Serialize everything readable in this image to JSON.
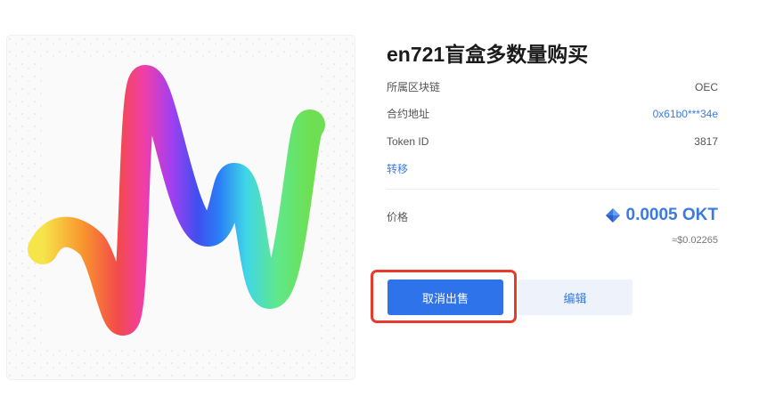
{
  "nft": {
    "title": "en721盲盒多数量购买",
    "details": [
      {
        "label": "所属区块链",
        "value": "OEC",
        "link": false
      },
      {
        "label": "合约地址",
        "value": "0x61b0***34e",
        "link": true
      },
      {
        "label": "Token ID",
        "value": "3817",
        "link": false
      }
    ],
    "transfer_label": "转移",
    "price_label": "价格",
    "price_value": "0.0005 OKT",
    "price_usd": "≈$0.02265",
    "currency_icon": "okt-diamond-icon"
  },
  "actions": {
    "cancel_sale_label": "取消出售",
    "edit_label": "编辑"
  },
  "colors": {
    "accent": "#2f73ea",
    "link": "#3b7be0",
    "highlight": "#e83a2a"
  }
}
